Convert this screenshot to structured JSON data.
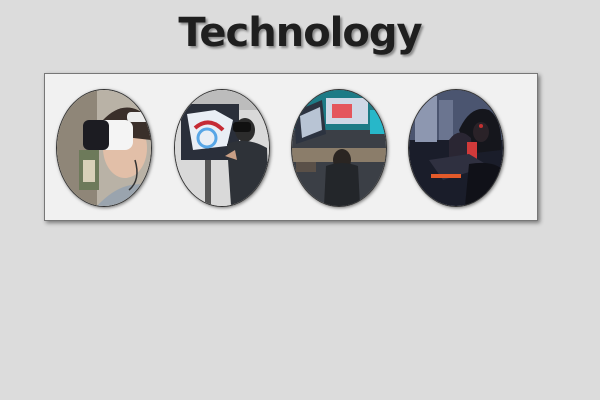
{
  "page": {
    "title": "Technology"
  },
  "gallery": {
    "items": [
      {
        "icon": "vr-headset-photo-icon"
      },
      {
        "icon": "vr-cockpit-photo-icon"
      },
      {
        "icon": "workstation-photo-icon"
      },
      {
        "icon": "hacker-hoodie-photo-icon"
      }
    ]
  },
  "colors": {
    "background": "#dcdcdc",
    "panel": "#f1f1f1",
    "title": "#1f1f1f"
  }
}
